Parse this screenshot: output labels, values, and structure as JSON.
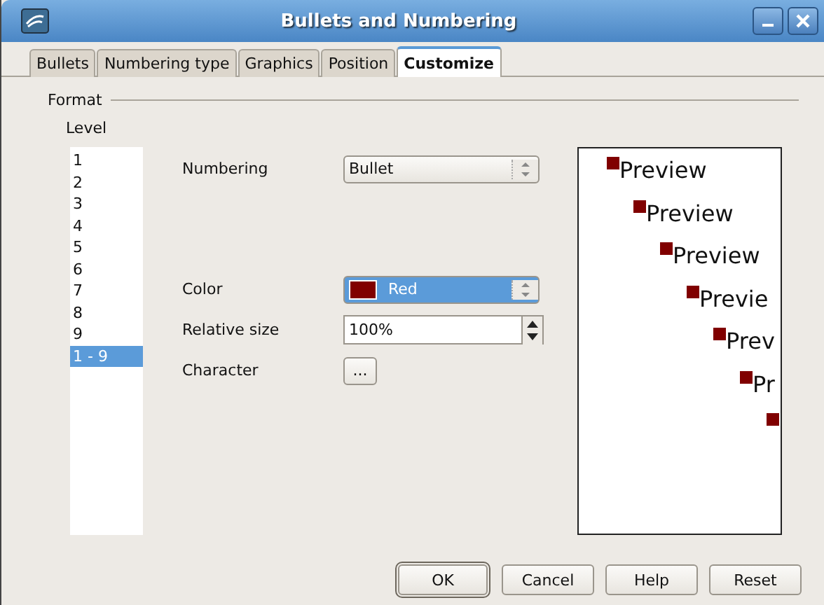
{
  "window": {
    "title": "Bullets and Numbering"
  },
  "tabs": [
    {
      "label": "Bullets",
      "selected": false
    },
    {
      "label": "Numbering type",
      "selected": false
    },
    {
      "label": "Graphics",
      "selected": false
    },
    {
      "label": "Position",
      "selected": false
    },
    {
      "label": "Customize",
      "selected": true
    }
  ],
  "format": {
    "title": "Format",
    "level_label": "Level",
    "levels": [
      {
        "label": "1",
        "selected": false
      },
      {
        "label": "2",
        "selected": false
      },
      {
        "label": "3",
        "selected": false
      },
      {
        "label": "4",
        "selected": false
      },
      {
        "label": "5",
        "selected": false
      },
      {
        "label": "6",
        "selected": false
      },
      {
        "label": "7",
        "selected": false
      },
      {
        "label": "8",
        "selected": false
      },
      {
        "label": "9",
        "selected": false
      },
      {
        "label": "1 - 9",
        "selected": true
      }
    ],
    "numbering": {
      "label": "Numbering",
      "value": "Bullet"
    },
    "color": {
      "label": "Color",
      "value": "Red",
      "color": "#800000"
    },
    "relative_size": {
      "label": "Relative size",
      "value": "100%"
    },
    "character": {
      "label": "Character",
      "button": "..."
    },
    "preview": [
      {
        "kind": "text",
        "text": "Preview"
      },
      {
        "kind": "text",
        "text": "Preview"
      },
      {
        "kind": "text",
        "text": "Preview"
      },
      {
        "kind": "text",
        "text": "Previe"
      },
      {
        "kind": "text",
        "text": "Prev"
      },
      {
        "kind": "text",
        "text": "Pr"
      },
      {
        "kind": "bullet"
      }
    ]
  },
  "buttons": [
    "OK",
    "Cancel",
    "Help",
    "Reset"
  ]
}
